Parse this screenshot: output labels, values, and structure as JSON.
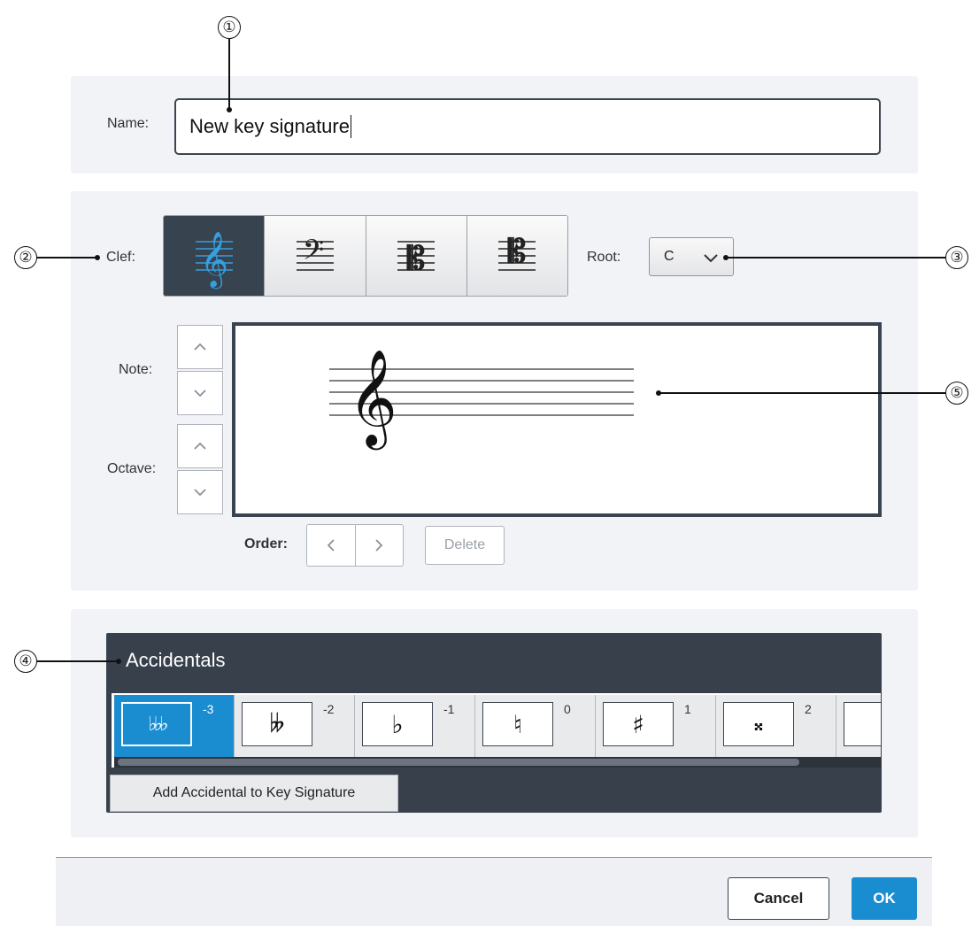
{
  "callouts": [
    "①",
    "②",
    "③",
    "④",
    "⑤"
  ],
  "name_field": {
    "label": "Name:",
    "value": "New key signature"
  },
  "clef": {
    "label": "Clef:",
    "options": [
      "treble-clef",
      "bass-clef",
      "alto-clef",
      "tenor-clef"
    ],
    "selected": "treble-clef"
  },
  "root": {
    "label": "Root:",
    "value": "C"
  },
  "note": {
    "label": "Note:"
  },
  "octave": {
    "label": "Octave:"
  },
  "order": {
    "label": "Order:",
    "delete_label": "Delete"
  },
  "accidentals": {
    "title": "Accidentals",
    "items": [
      {
        "symbol": "♭♭♭",
        "value": "-3",
        "selected": true
      },
      {
        "symbol": "𝄫",
        "value": "-2",
        "selected": false
      },
      {
        "symbol": "♭",
        "value": "-1",
        "selected": false
      },
      {
        "symbol": "♮",
        "value": "0",
        "selected": false
      },
      {
        "symbol": "♯",
        "value": "1",
        "selected": false
      },
      {
        "symbol": "𝄪",
        "value": "2",
        "selected": false
      }
    ],
    "add_button": "Add Accidental to Key Signature"
  },
  "footer": {
    "cancel": "Cancel",
    "ok": "OK"
  },
  "colors": {
    "accent": "#1a8cd0",
    "dark": "#38414b",
    "panel": "#f1f3f7"
  }
}
